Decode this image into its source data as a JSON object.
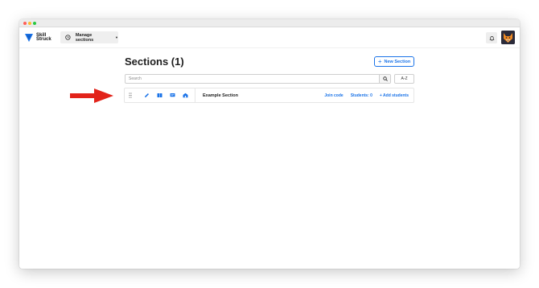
{
  "brand": {
    "name": "Skill Struck",
    "line1": "Skill",
    "line2": "Struck",
    "color": "#1a73e8"
  },
  "header": {
    "manage_label": "Manage sections",
    "clock_icon": "clock-icon",
    "caret_icon": "caret-down-icon",
    "notifications_icon": "bell-icon",
    "avatar": "fox-avatar"
  },
  "main": {
    "title": "Sections (1)",
    "new_section_label": "New Section",
    "search": {
      "placeholder": "Search",
      "value": ""
    },
    "sort_label": "A-Z",
    "sections": [
      {
        "name": "Example Section",
        "join_code_label": "Join code",
        "students_label": "Students: 0",
        "add_students_label": "Add students",
        "icons": [
          "edit-icon",
          "book-icon",
          "message-icon",
          "school-icon"
        ]
      }
    ]
  },
  "colors": {
    "accent": "#1a73e8",
    "arrow": "#e2231a"
  }
}
